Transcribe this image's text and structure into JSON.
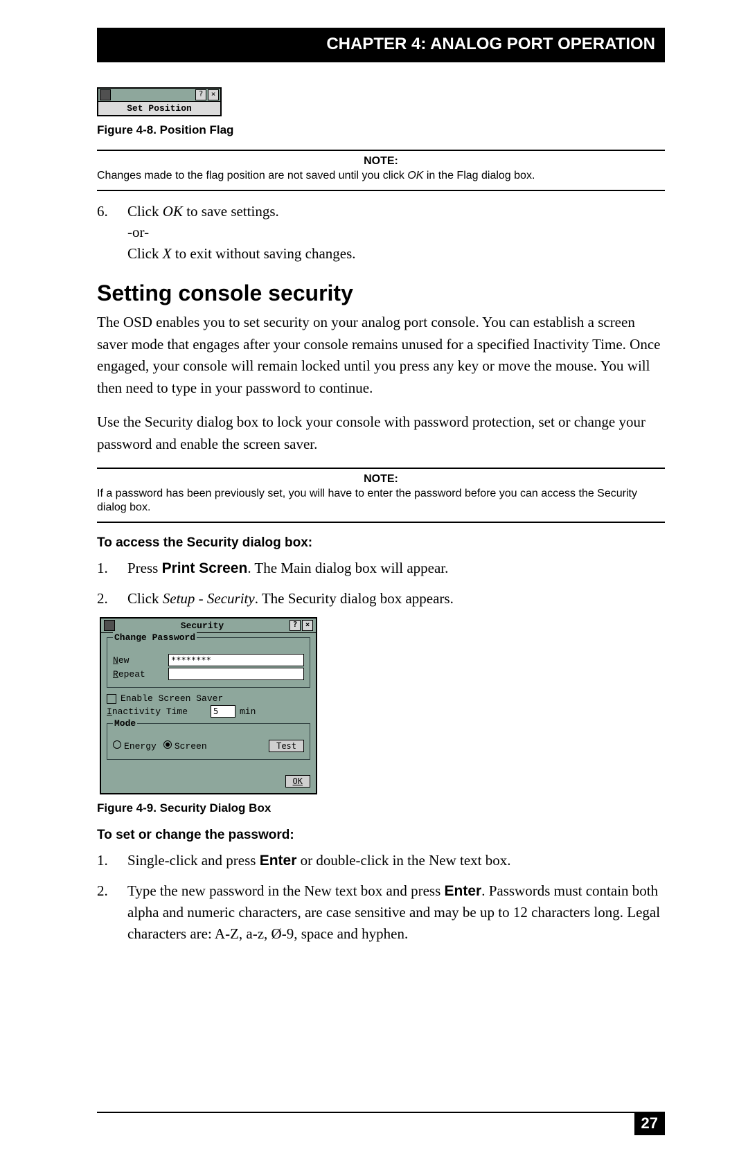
{
  "header": {
    "chapter": "CHAPTER 4: ANALOG PORT OPERATION"
  },
  "fig48": {
    "flag_text": "Set Position",
    "help": "?",
    "close": "×",
    "caption": "Figure 4-8. Position Flag"
  },
  "note1": {
    "label": "NOTE:",
    "text_a": "Changes made to the flag position are not saved until you click ",
    "ok_it": "OK",
    "text_b": " in the Flag dialog box."
  },
  "step6": {
    "num": "6.",
    "l1a": "Click ",
    "l1_ok": "OK",
    "l1b": " to save settings.",
    "l2": "-or-",
    "l3a": "Click ",
    "l3_x": "X",
    "l3b": " to exit without saving changes."
  },
  "section_title": "Setting console security",
  "para1": "The OSD enables you to set security on your analog port console. You can establish a screen saver mode that engages after your console remains unused for a specified Inactivity Time. Once engaged, your console will remain locked until you press any key or move the mouse. You will then need to type in your password to continue.",
  "para2": "Use the Security dialog box to lock your console with password protection, set or change your password and enable the screen saver.",
  "note2": {
    "label": "NOTE:",
    "text": "If a password has been previously set, you will have to enter the password before you can access the Security dialog box."
  },
  "sub_access": "To access the Security dialog box:",
  "access_steps": {
    "s1": {
      "num": "1.",
      "a": "Press ",
      "b": "Print Screen",
      "c": ". The Main dialog box will appear."
    },
    "s2": {
      "num": "2.",
      "a": "Click ",
      "b": "Setup - Security",
      "c": ". The Security dialog box appears."
    }
  },
  "sec_dialog": {
    "title": "Security",
    "help": "?",
    "close": "×",
    "change_pw": "Change Password",
    "new_u": "N",
    "new_rest": "ew",
    "repeat_u": "R",
    "repeat_rest": "epeat",
    "new_val": "********",
    "enable_ss_a": "Enable ",
    "enable_ss_u": "S",
    "enable_ss_b": "creen Saver",
    "inact_u": "I",
    "inact_rest": "nactivity Time",
    "inact_val": "5",
    "min": "min",
    "mode": "Mode",
    "energy_u": "E",
    "energy_rest": "nergy",
    "screen_u": "S",
    "screen_rest": "creen",
    "test": "Test",
    "ok": "OK"
  },
  "fig49_caption": "Figure 4-9. Security Dialog Box",
  "sub_setpw": "To set or change the password:",
  "pw_steps": {
    "s1": {
      "num": "1.",
      "a": "Single-click and press ",
      "b": "Enter",
      "c": " or double-click in the New text box."
    },
    "s2": {
      "num": "2.",
      "a": "Type the new password in the New text box and press ",
      "b": "Enter",
      "c": ". Passwords must contain both alpha and numeric characters, are case sensitive and may be up to 12 characters long. Legal characters are: A-Z, a-z, Ø-9, space and hyphen."
    }
  },
  "page_number": "27"
}
